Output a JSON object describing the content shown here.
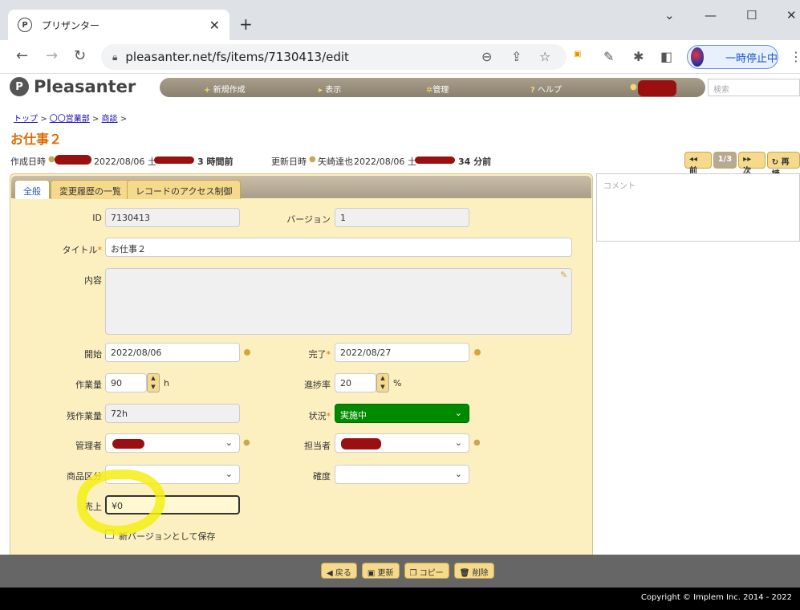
{
  "browser": {
    "tab_title": "プリザンター",
    "tab_favicon": "P",
    "url": "pleasanter.net/fs/items/7130413/edit",
    "pause_label": "一時停止中"
  },
  "app": {
    "logo": "Pleasanter",
    "logo_mark": "P",
    "nav": {
      "new": "新規作成",
      "view": "表示",
      "manage": "管理",
      "help": "ヘルプ"
    },
    "search_placeholder": "検索"
  },
  "breadcrumb": {
    "top": "トップ",
    "dept": "〇〇営業部",
    "deals": "商談",
    "sep": ">"
  },
  "page_title": "お仕事２",
  "meta": {
    "created_label": "作成日時",
    "created_date": "2022/08/06 土",
    "created_ago": "3 時間前",
    "updated_label": "更新日時",
    "updated_user": "矢崎達也",
    "updated_date": "2022/08/06 土",
    "updated_ago": "34 分前"
  },
  "pager": {
    "prev": "前",
    "current": "1/3",
    "next": "次",
    "reload": "再読"
  },
  "tabs": [
    "全般",
    "変更履歴の一覧",
    "レコードのアクセス制御"
  ],
  "comment_placeholder": "コメント",
  "form": {
    "id_label": "ID",
    "id_value": "7130413",
    "version_label": "バージョン",
    "version_value": "1",
    "title_label": "タイトル",
    "title_value": "お仕事２",
    "body_label": "内容",
    "start_label": "開始",
    "start_value": "2022/08/06",
    "end_label": "完了",
    "end_value": "2022/08/27",
    "work_label": "作業量",
    "work_value": "90",
    "work_unit": "h",
    "progress_label": "進捗率",
    "progress_value": "20",
    "progress_unit": "%",
    "remain_label": "残作業量",
    "remain_value": "72h",
    "status_label": "状況",
    "status_value": "実施中",
    "manager_label": "管理者",
    "owner_label": "担当者",
    "category_label": "商品区分",
    "certainty_label": "確度",
    "sales_label": "売上",
    "sales_value": "¥0",
    "new_version_label": "新バージョンとして保存",
    "required_mark": "*"
  },
  "commands": {
    "back": "戻る",
    "update": "更新",
    "copy": "コピー",
    "delete": "削除"
  },
  "footer": "Copyright © Implem Inc. 2014 - 2022",
  "colors": {
    "accent": "#e06a00",
    "status_green": "#008a00",
    "form_bg": "#fdf0c0",
    "button": "#f5d98c"
  }
}
